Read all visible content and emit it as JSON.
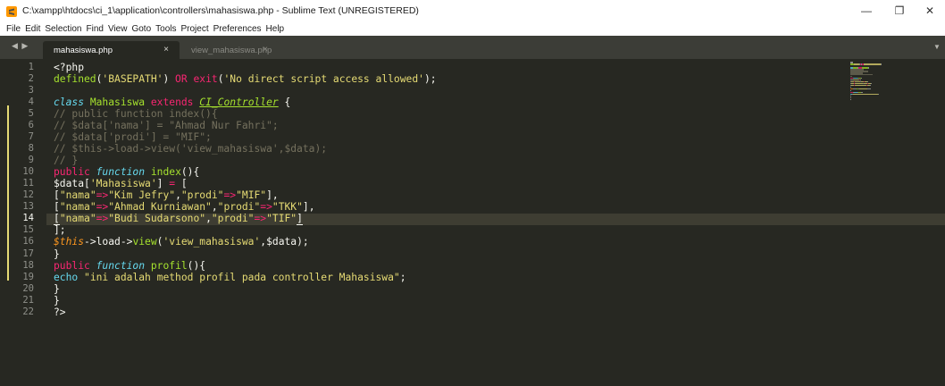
{
  "window": {
    "title": "C:\\xampp\\htdocs\\ci_1\\application\\controllers\\mahasiswa.php - Sublime Text (UNREGISTERED)",
    "minimize": "—",
    "maximize": "❐",
    "close": "✕"
  },
  "menu": [
    "File",
    "Edit",
    "Selection",
    "Find",
    "View",
    "Goto",
    "Tools",
    "Project",
    "Preferences",
    "Help"
  ],
  "tabs": {
    "nav": "◀ ▶",
    "active": {
      "label": "mahasiswa.php",
      "close": "×"
    },
    "inactive": {
      "label": "view_mahasiswa.php",
      "close": "×"
    },
    "dropdown": "▼"
  },
  "editor": {
    "current_line": 14,
    "line_numbers": [
      "1",
      "2",
      "3",
      "4",
      "5",
      "6",
      "7",
      "8",
      "9",
      "10",
      "11",
      "12",
      "13",
      "14",
      "15",
      "16",
      "17",
      "18",
      "19",
      "20",
      "21",
      "22"
    ],
    "lines": [
      [
        {
          "t": "<?php",
          "c": ""
        }
      ],
      [
        {
          "t": "defined",
          "c": "f"
        },
        {
          "t": "(",
          "c": ""
        },
        {
          "t": "'BASEPATH'",
          "c": "s"
        },
        {
          "t": ") ",
          "c": ""
        },
        {
          "t": "OR",
          "c": "k"
        },
        {
          "t": " ",
          "c": ""
        },
        {
          "t": "exit",
          "c": "k"
        },
        {
          "t": "(",
          "c": ""
        },
        {
          "t": "'No direct script access allowed'",
          "c": "s"
        },
        {
          "t": ");",
          "c": ""
        }
      ],
      [],
      [
        {
          "t": "class",
          "c": "i"
        },
        {
          "t": " ",
          "c": ""
        },
        {
          "t": "Mahasiswa",
          "c": "f"
        },
        {
          "t": " ",
          "c": ""
        },
        {
          "t": "extends",
          "c": "k"
        },
        {
          "t": " ",
          "c": ""
        },
        {
          "t": "CI_Controller",
          "c": "cls"
        },
        {
          "t": " {",
          "c": ""
        }
      ],
      [
        {
          "t": "// public function index(){",
          "c": "c"
        }
      ],
      [
        {
          "t": "// $data['nama'] = \"Ahmad Nur Fahri\";",
          "c": "c"
        }
      ],
      [
        {
          "t": "// $data['prodi'] = \"MIF\";",
          "c": "c"
        }
      ],
      [
        {
          "t": "// $this->load->view('view_mahasiswa',$data);",
          "c": "c"
        }
      ],
      [
        {
          "t": "// }",
          "c": "c"
        }
      ],
      [
        {
          "t": "public",
          "c": "k"
        },
        {
          "t": " ",
          "c": ""
        },
        {
          "t": "function",
          "c": "i"
        },
        {
          "t": " ",
          "c": ""
        },
        {
          "t": "index",
          "c": "f"
        },
        {
          "t": "(){",
          "c": ""
        }
      ],
      [
        {
          "t": "$data[",
          "c": ""
        },
        {
          "t": "'Mahasiswa'",
          "c": "s"
        },
        {
          "t": "] ",
          "c": ""
        },
        {
          "t": "=",
          "c": "k"
        },
        {
          "t": " [",
          "c": ""
        }
      ],
      [
        {
          "t": "[",
          "c": ""
        },
        {
          "t": "\"nama\"",
          "c": "s"
        },
        {
          "t": "=>",
          "c": "k"
        },
        {
          "t": "\"Kim Jefry\"",
          "c": "s"
        },
        {
          "t": ",",
          "c": ""
        },
        {
          "t": "\"prodi\"",
          "c": "s"
        },
        {
          "t": "=>",
          "c": "k"
        },
        {
          "t": "\"MIF\"",
          "c": "s"
        },
        {
          "t": "],",
          "c": ""
        }
      ],
      [
        {
          "t": "[",
          "c": ""
        },
        {
          "t": "\"nama\"",
          "c": "s"
        },
        {
          "t": "=>",
          "c": "k"
        },
        {
          "t": "\"Ahmad Kurniawan\"",
          "c": "s"
        },
        {
          "t": ",",
          "c": ""
        },
        {
          "t": "\"prodi\"",
          "c": "s"
        },
        {
          "t": "=>",
          "c": "k"
        },
        {
          "t": "\"TKK\"",
          "c": "s"
        },
        {
          "t": "],",
          "c": ""
        }
      ],
      [
        {
          "t": "[",
          "c": "bracket-u"
        },
        {
          "t": "\"nama\"",
          "c": "s"
        },
        {
          "t": "=>",
          "c": "k"
        },
        {
          "t": "\"Budi Sudarsono\"",
          "c": "s"
        },
        {
          "t": ",",
          "c": ""
        },
        {
          "t": "\"prodi\"",
          "c": "s"
        },
        {
          "t": "=>",
          "c": "k"
        },
        {
          "t": "\"TIF\"",
          "c": "s"
        },
        {
          "t": "]",
          "c": "bracket-u"
        }
      ],
      [
        {
          "t": "];",
          "c": ""
        }
      ],
      [
        {
          "t": "$this",
          "c": "self"
        },
        {
          "t": "->load->",
          "c": ""
        },
        {
          "t": "view",
          "c": "f"
        },
        {
          "t": "(",
          "c": ""
        },
        {
          "t": "'view_mahasiswa'",
          "c": "s"
        },
        {
          "t": ",$data);",
          "c": ""
        }
      ],
      [
        {
          "t": "}",
          "c": ""
        }
      ],
      [
        {
          "t": "public",
          "c": "k"
        },
        {
          "t": " ",
          "c": ""
        },
        {
          "t": "function",
          "c": "i"
        },
        {
          "t": " ",
          "c": ""
        },
        {
          "t": "profil",
          "c": "f"
        },
        {
          "t": "(){",
          "c": ""
        }
      ],
      [
        {
          "t": "echo",
          "c": "fn"
        },
        {
          "t": " ",
          "c": ""
        },
        {
          "t": "\"ini adalah method profil pada controller Mahasiswa\"",
          "c": "s"
        },
        {
          "t": ";",
          "c": ""
        }
      ],
      [
        {
          "t": "}",
          "c": ""
        }
      ],
      [
        {
          "t": "}",
          "c": ""
        }
      ],
      [
        {
          "t": "?>",
          "c": ""
        }
      ]
    ]
  },
  "colors": {
    "background": "#272822",
    "tabbar": "#3c3d37",
    "keyword": "#f92672",
    "string": "#e6db74",
    "comment": "#75715e",
    "function": "#a6e22e",
    "storage": "#66d9ef",
    "variable": "#fd971f",
    "modified_marker": "#e6db74"
  },
  "icons": {
    "app": "sublime-text-icon",
    "minimize": "minimize-icon",
    "maximize": "restore-icon",
    "close": "close-icon"
  }
}
